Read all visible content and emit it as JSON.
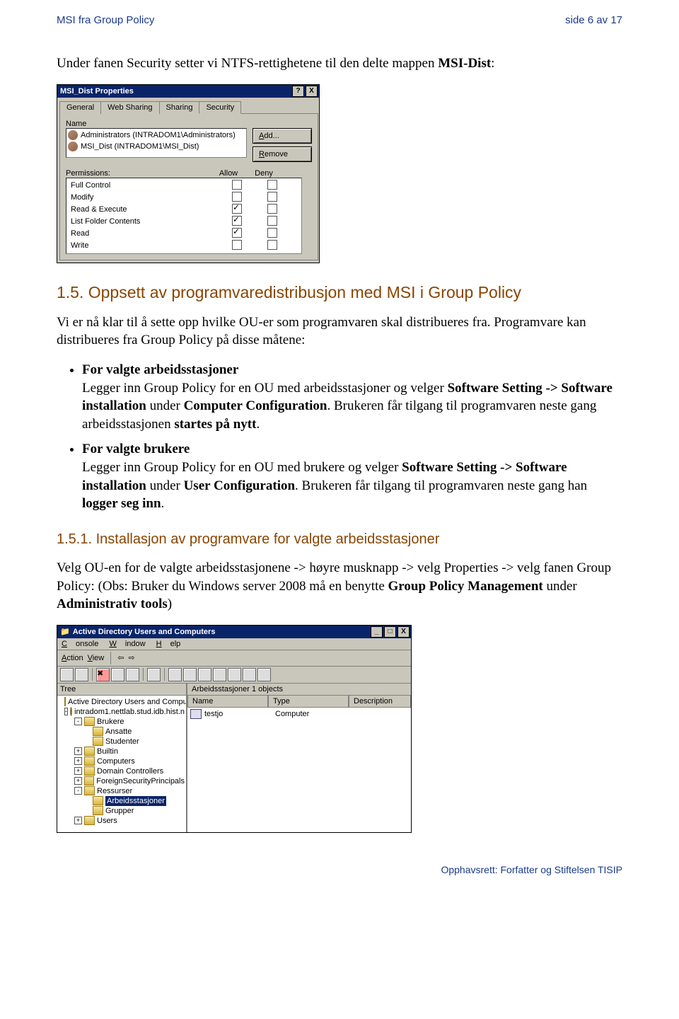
{
  "header": {
    "left": "MSI fra Group Policy",
    "right": "side 6 av 17"
  },
  "intro": {
    "pre": "Under fanen Security setter vi NTFS-rettighetene til den delte mappen ",
    "bold": "MSI-Dist",
    "post": ":"
  },
  "dlg1": {
    "title": "MSI_Dist Properties",
    "help": "?",
    "close": "X",
    "tabs": {
      "general": "General",
      "web": "Web Sharing",
      "sharing": "Sharing",
      "security": "Security"
    },
    "name_label": "Name",
    "add_btn": "Add...",
    "remove_btn": "Remove",
    "list": {
      "row1": "Administrators (INTRADOM1\\Administrators)",
      "row2": "MSI_Dist (INTRADOM1\\MSI_Dist)"
    },
    "perm_label": "Permissions:",
    "col_allow": "Allow",
    "col_deny": "Deny",
    "perms": {
      "full": "Full Control",
      "modify": "Modify",
      "rex": "Read & Execute",
      "list": "List Folder Contents",
      "read": "Read",
      "write": "Write"
    }
  },
  "section15": {
    "title": "1.5. Oppsett av programvaredistribusjon med MSI i Group Policy",
    "p1": "Vi er nå klar til å sette opp hvilke OU-er som programvaren skal distribueres fra. Programvare kan distribueres fra Group Policy på disse måtene:",
    "b1": {
      "head": "For valgte arbeidsstasjoner",
      "t1": "Legger inn Group Policy for en OU med arbeidsstasjoner og velger ",
      "s1": "Software Setting -> Software installation",
      "t2": " under ",
      "s2": "Computer Configuration",
      "t3": ". Brukeren får tilgang til programvaren neste gang arbeidsstasjonen ",
      "s3": "startes på nytt",
      "t4": "."
    },
    "b2": {
      "head": "For valgte brukere",
      "t1": "Legger inn Group Policy for en OU med brukere og velger ",
      "s1": "Software Setting -> Software installation",
      "t2": " under ",
      "s2": "User Configuration",
      "t3": ". Brukeren får tilgang til programvaren neste gang han ",
      "s3": "logger seg inn",
      "t4": "."
    }
  },
  "section151": {
    "title": "1.5.1. Installasjon av programvare for valgte arbeidsstasjoner",
    "p_pre": "Velg OU-en for de valgte arbeidsstasjonene -> høyre musknapp -> velg Properties -> velg fanen Group Policy: (Obs: Bruker du Windows server 2008 må en benytte ",
    "p_b1": "Group Policy Management",
    "p_mid": " under ",
    "p_b2": "Administrativ tools",
    "p_post": ")"
  },
  "dlg2": {
    "title": "Active Directory Users and Computers",
    "menu": {
      "console": "Console",
      "window": "Window",
      "help": "Help"
    },
    "sub": {
      "action": "Action",
      "view": "View"
    },
    "treehdr": "Tree",
    "tree": {
      "root": "Active Directory Users and Computer",
      "domain": "intradom1.nettlab.stud.idb.hist.n",
      "brukere": "Brukere",
      "ansatte": "Ansatte",
      "studenter": "Studenter",
      "builtin": "Builtin",
      "computers": "Computers",
      "dc": "Domain Controllers",
      "fsp": "ForeignSecurityPrincipals",
      "ressurser": "Ressurser",
      "arb": "Arbeidsstasjoner",
      "grupper": "Grupper",
      "users": "Users"
    },
    "listhdr": {
      "count": "Arbeidsstasjoner   1 objects",
      "name": "Name",
      "type": "Type",
      "desc": "Description"
    },
    "listrow": {
      "name": "testjo",
      "type": "Computer"
    }
  },
  "footer": "Opphavsrett:  Forfatter og Stiftelsen TISIP"
}
